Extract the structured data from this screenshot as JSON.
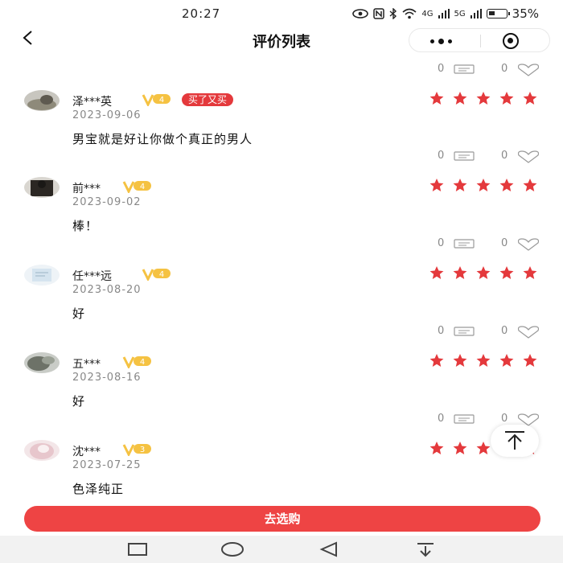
{
  "status_bar": {
    "time": "20:27",
    "network": "4G",
    "network2": "5G",
    "battery": "35%"
  },
  "header": {
    "title": "评价列表",
    "back_icon": "back-arrow-icon",
    "menu_icon": "more-dots-icon",
    "close_icon": "target-icon"
  },
  "top_counts": {
    "comments": "0",
    "likes": "0"
  },
  "reviews": [
    {
      "username": "泽***英",
      "vip_level": "4",
      "tag": "买了又买",
      "date": "2023-09-06",
      "content": "男宝就是好让你做个真正的男人",
      "stars": 5,
      "comments": "0",
      "likes": "0"
    },
    {
      "username": "前***",
      "vip_level": "4",
      "date": "2023-09-02",
      "content": "棒！",
      "stars": 5,
      "comments": "0",
      "likes": "0"
    },
    {
      "username": "任***远",
      "vip_level": "4",
      "date": "2023-08-20",
      "content": "好",
      "stars": 5,
      "comments": "0",
      "likes": "0"
    },
    {
      "username": "五***",
      "vip_level": "4",
      "date": "2023-08-16",
      "content": "好",
      "stars": 5,
      "comments": "0",
      "likes": "0"
    },
    {
      "username": "沈***",
      "vip_level": "3",
      "date": "2023-07-25",
      "content": "色泽纯正",
      "stars": 5
    }
  ],
  "bottom_button": {
    "label": "去选购"
  },
  "colors": {
    "accent": "#ee4444",
    "star": "#e4393c",
    "vip_gold": "#f5c242"
  }
}
